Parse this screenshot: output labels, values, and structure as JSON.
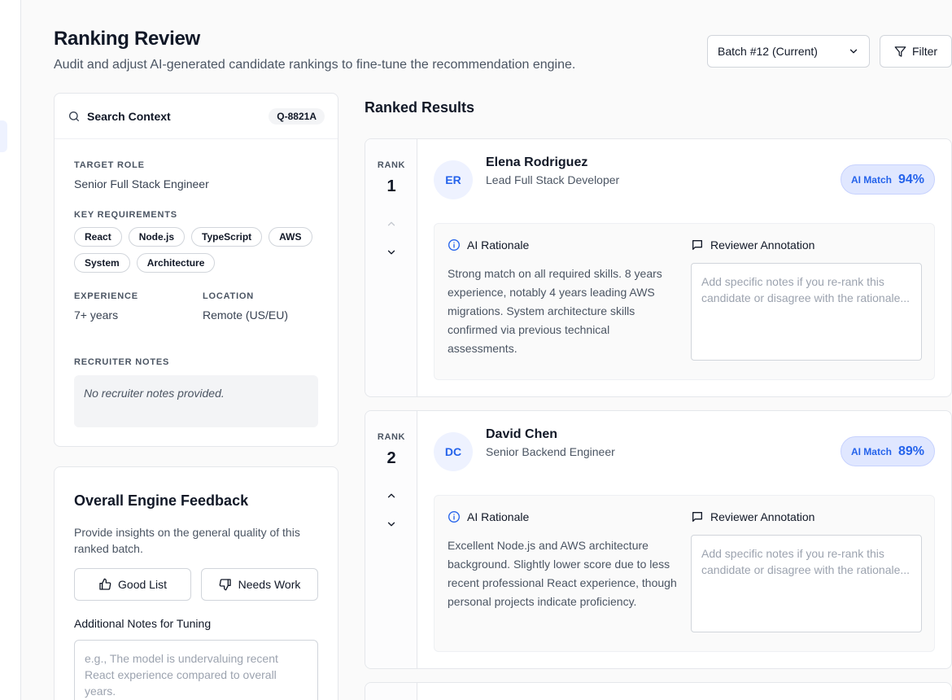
{
  "header": {
    "title": "Ranking Review",
    "subtitle": "Audit and adjust AI-generated candidate rankings to fine-tune the recommendation engine.",
    "batch_select": "Batch #12 (Current)",
    "filter_label": "Filter"
  },
  "context": {
    "title": "Search Context",
    "query_id": "Q-8821A",
    "target_role_label": "TARGET ROLE",
    "target_role": "Senior Full Stack Engineer",
    "requirements_label": "KEY REQUIREMENTS",
    "requirements": [
      "React",
      "Node.js",
      "TypeScript",
      "AWS",
      "System",
      "Architecture"
    ],
    "experience_label": "EXPERIENCE",
    "experience": "7+ years",
    "location_label": "LOCATION",
    "location": "Remote (US/EU)",
    "notes_label": "RECRUITER NOTES",
    "notes": "No recruiter notes provided."
  },
  "feedback": {
    "title": "Overall Engine Feedback",
    "description": "Provide insights on the general quality of this ranked batch.",
    "good_label": "Good List",
    "needs_work_label": "Needs Work",
    "notes_label": "Additional Notes for Tuning",
    "notes_placeholder": "e.g., The model is undervaluing recent React experience compared to overall years."
  },
  "results": {
    "title": "Ranked Results",
    "rank_label": "RANK",
    "match_label": "AI Match",
    "rationale_label": "AI Rationale",
    "annotation_label": "Reviewer Annotation",
    "annotation_placeholder": "Add specific notes if you re-rank this candidate or disagree with the rationale...",
    "candidates": [
      {
        "rank": "1",
        "initials": "ER",
        "name": "Elena Rodriguez",
        "title": "Lead Full Stack Developer",
        "match": "94%",
        "rationale": "Strong match on all required skills. 8 years experience, notably 4 years leading AWS migrations. System architecture skills confirmed via previous technical assessments."
      },
      {
        "rank": "2",
        "initials": "DC",
        "name": "David Chen",
        "title": "Senior Backend Engineer",
        "match": "89%",
        "rationale": "Excellent Node.js and AWS architecture background. Slightly lower score due to less recent professional React experience, though personal projects indicate proficiency."
      }
    ]
  },
  "colors": {
    "accent": "#2563eb",
    "accent_bg": "#e0e7ff",
    "border": "#e5e7eb"
  }
}
